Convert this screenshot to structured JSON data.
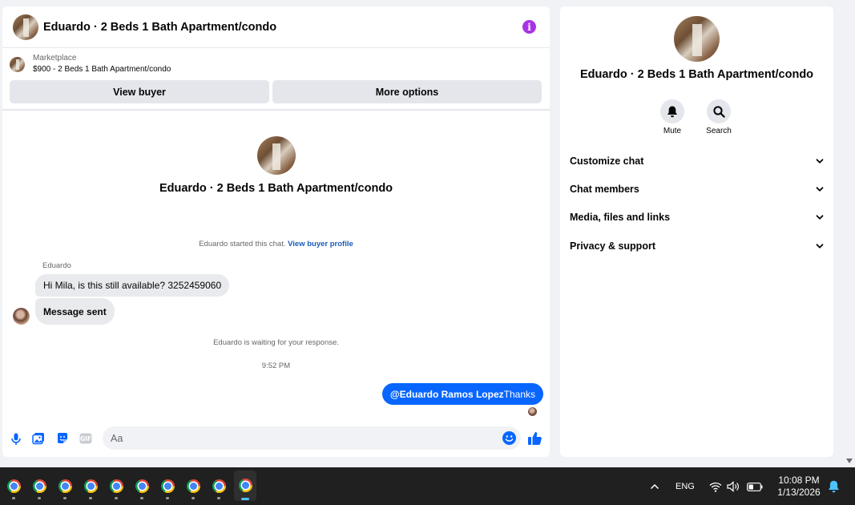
{
  "chat": {
    "header_title": "Eduardo · 2 Beds 1 Bath Apartment/condo",
    "marketplace_label": "Marketplace",
    "listing_summary": "$900 - 2 Beds 1 Bath Apartment/condo",
    "view_buyer_label": "View buyer",
    "more_options_label": "More options",
    "intro_title": "Eduardo · 2 Beds 1 Bath Apartment/condo",
    "started_text": "Eduardo started this chat.",
    "view_buyer_profile_link": "View buyer profile",
    "sender_name": "Eduardo",
    "messages": [
      {
        "text": "Hi Mila, is this still available? 3252459060"
      },
      {
        "text": "Message sent"
      }
    ],
    "waiting_text": "Eduardo is waiting for your response.",
    "timestamp": "9:52 PM",
    "outgoing_mention": "@Eduardo Ramos Lopez",
    "outgoing_text": "Thanks",
    "input_placeholder": "Aa"
  },
  "info_panel": {
    "title": "Eduardo · 2 Beds 1 Bath Apartment/condo",
    "mute_label": "Mute",
    "search_label": "Search",
    "sections": [
      {
        "label": "Customize chat"
      },
      {
        "label": "Chat members"
      },
      {
        "label": "Media, files and links"
      },
      {
        "label": "Privacy & support"
      }
    ]
  },
  "taskbar": {
    "language": "ENG",
    "time": "10:08 PM",
    "date": "1/13/2026",
    "app_count": 10
  },
  "colors": {
    "accent_blue": "#0866ff",
    "info_purple": "#a833e6",
    "taskbar_bg": "#202020"
  }
}
